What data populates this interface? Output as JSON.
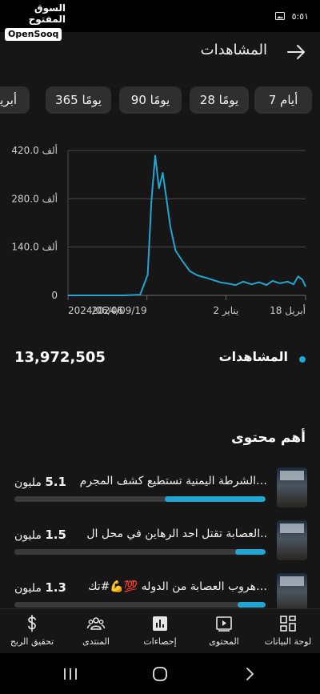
{
  "status": {
    "time": "٥:٥١",
    "brand_ar": "السوق المفتوح",
    "brand_en": "OpenSooq"
  },
  "header": {
    "title": "المشاهدات"
  },
  "ranges": [
    {
      "label": "7 أيام"
    },
    {
      "label": "28 يومًا"
    },
    {
      "label": "90 يومًا"
    },
    {
      "label": "365 يومًا"
    },
    {
      "label": "أبريل"
    }
  ],
  "chart_data": {
    "type": "line",
    "title": "",
    "xlabel": "",
    "ylabel": "",
    "ylim": [
      0,
      420000
    ],
    "y_ticks": [
      "420.0 ألف",
      "280.0 ألف",
      "140.0 ألف",
      "0"
    ],
    "x_ticks": [
      "2024/06/06",
      "2024/09/19",
      "2 يناير",
      "18 أبريل"
    ],
    "grid": true,
    "color": "#22a5d2",
    "series": [
      {
        "x": [
          "2024/06/06",
          "2024/07/15",
          "2024/08/20",
          "2024/09/10",
          "2024/09/20",
          "2024/09/25",
          "2024/09/30",
          "2024/10/05",
          "2024/10/10",
          "2024/10/15",
          "2024/10/20",
          "2024/10/27",
          "2024/11/05",
          "2024/11/15",
          "2024/11/25",
          "2024/12/05",
          "2024/12/15",
          "2024/12/25",
          "2025/01/05",
          "2025/01/15",
          "2025/01/25",
          "2025/02/05",
          "2025/02/15",
          "2025/02/25",
          "2025/03/05",
          "2025/03/15",
          "2025/03/25",
          "2025/04/02",
          "2025/04/08",
          "2025/04/14",
          "2025/04/18"
        ],
        "y": [
          0,
          0,
          0,
          2000,
          60000,
          275000,
          405000,
          310000,
          355000,
          280000,
          200000,
          130000,
          100000,
          70000,
          58000,
          52000,
          45000,
          38000,
          34000,
          30000,
          40000,
          32000,
          38000,
          30000,
          42000,
          35000,
          40000,
          32000,
          55000,
          45000,
          25000
        ]
      }
    ]
  },
  "summary": {
    "label": "المشاهدات",
    "total": "13,972,505"
  },
  "top_content": {
    "title": "أهم محتوى",
    "items": [
      {
        "title": "الشرطة اليمنية تستطيع كشف المجرم…",
        "count_value": "5.1",
        "count_unit": "مليون",
        "share": 0.4
      },
      {
        "title": "العصابة تقتل احد الرهاين في محل ال..",
        "count_value": "1.5",
        "count_unit": "مليون",
        "share": 0.12
      },
      {
        "title": "هروب العصابة من الدوله 💯💪#تك…",
        "count_value": "1.3",
        "count_unit": "مليون",
        "share": 0.11
      }
    ]
  },
  "bottom_nav": [
    {
      "label": "لوحة البيانات",
      "icon": "dashboard-icon"
    },
    {
      "label": "المحتوى",
      "icon": "content-icon"
    },
    {
      "label": "إحصاءات",
      "icon": "analytics-icon"
    },
    {
      "label": "المنتدى",
      "icon": "community-icon"
    },
    {
      "label": "تحقيق الربح",
      "icon": "dollar-icon"
    }
  ]
}
